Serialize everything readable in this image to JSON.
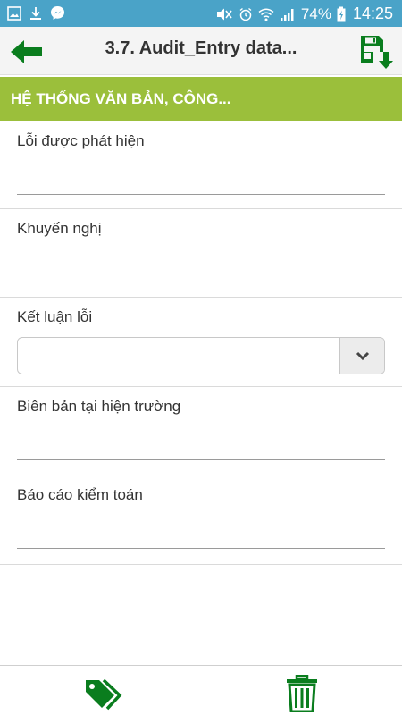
{
  "status_bar": {
    "battery_percent": "74%",
    "time": "14:25",
    "icons": [
      "gallery-icon",
      "download-icon",
      "messenger-icon",
      "mute-icon",
      "alarm-icon",
      "wifi-icon",
      "signal-icon",
      "battery-charging-icon"
    ]
  },
  "app_bar": {
    "title": "3.7. Audit_Entry data...",
    "back_icon": "arrow-left-icon",
    "save_icon": "save-download-icon",
    "accent_color": "#0a7d1e"
  },
  "section": {
    "title": "HỆ THỐNG VĂN BẢN, CÔNG...",
    "color": "#9bbf3b"
  },
  "fields": {
    "loi_phat_hien": {
      "label": "Lỗi được phát hiện",
      "value": ""
    },
    "khuyen_nghi": {
      "label": "Khuyến nghị",
      "value": ""
    },
    "ket_luan_loi": {
      "label": "Kết luận lỗi",
      "value": ""
    },
    "bien_ban": {
      "label": "Biên bản tại hiện trường",
      "value": ""
    },
    "bao_cao": {
      "label": "Báo cáo kiểm toán",
      "value": ""
    }
  },
  "bottom_bar": {
    "left_icon": "tags-icon",
    "right_icon": "trash-icon"
  }
}
